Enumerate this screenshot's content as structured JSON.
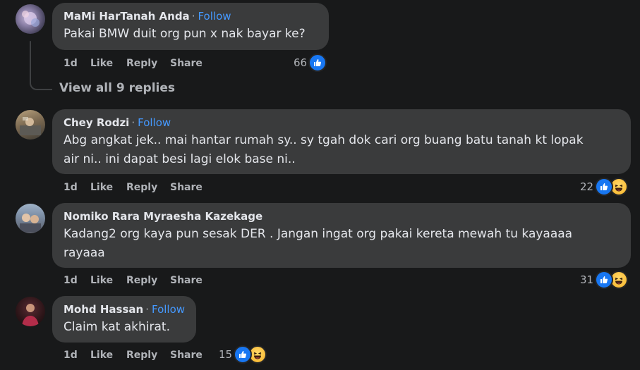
{
  "comments": [
    {
      "name": "MaMi HarTanah Anda",
      "follow": "Follow",
      "dot": "·",
      "text_lines": [
        "Pakai BMW duit org pun x nak bayar ke?"
      ],
      "time": "1d",
      "like": "Like",
      "reply": "Reply",
      "share": "Share",
      "reaction_count": "66",
      "reactions": [
        "like-icon"
      ]
    },
    {
      "name": "Chey Rodzi",
      "follow": "Follow",
      "dot": "·",
      "text_lines": [
        "Abg angkat jek.. mai hantar rumah sy.. sy tgah dok cari org buang batu tanah kt lopak",
        "air ni.. ini dapat besi lagi elok base ni.."
      ],
      "time": "1d",
      "like": "Like",
      "reply": "Reply",
      "share": "Share",
      "reaction_count": "22",
      "reactions": [
        "like-icon",
        "haha-icon"
      ]
    },
    {
      "name": "Nomiko Rara Myraesha Kazekage",
      "text_lines": [
        "Kadang2 org kaya pun sesak DER . Jangan ingat org pakai kereta mewah tu kayaaaa",
        "rayaaa"
      ],
      "time": "1d",
      "like": "Like",
      "reply": "Reply",
      "share": "Share",
      "reaction_count": "31",
      "reactions": [
        "like-icon",
        "haha-icon"
      ]
    },
    {
      "name": "Mohd Hassan",
      "follow": "Follow",
      "dot": "·",
      "text_lines": [
        "Claim kat akhirat."
      ],
      "time": "1d",
      "like": "Like",
      "reply": "Reply",
      "share": "Share",
      "reaction_count": "15",
      "reactions": [
        "like-icon",
        "haha-icon"
      ]
    }
  ],
  "view_replies": "View all 9 replies",
  "colors": {
    "background": "#18191a",
    "bubble": "#3a3b3c",
    "text": "#e4e6eb",
    "muted": "#b0b3b8",
    "follow": "#4599ff",
    "like": "#1877f2"
  }
}
